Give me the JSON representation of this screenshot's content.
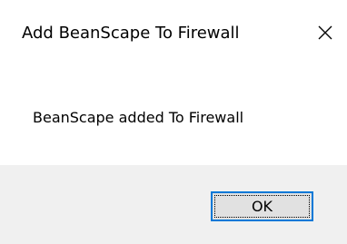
{
  "window": {
    "title": "Add BeanScape To Firewall",
    "close_icon": "close-icon"
  },
  "message": {
    "text": "BeanScape added To Firewall"
  },
  "footer": {
    "ok_label": "OK"
  },
  "colors": {
    "background": "#ffffff",
    "footer_background": "#f0f0f0",
    "button_background": "#e1e1e1",
    "button_focus_border": "#0078d7"
  }
}
